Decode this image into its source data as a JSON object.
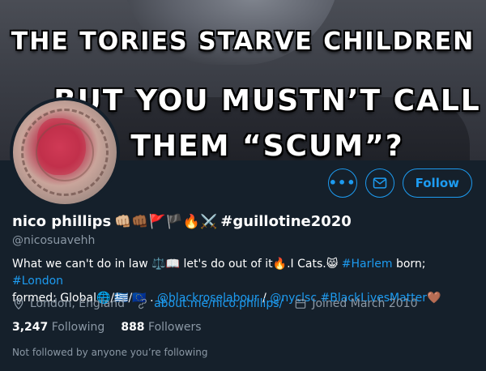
{
  "banner": {
    "line1": "THE TORIES STARVE CHILDREN",
    "line2": "BUT YOU MUSTN’T CALL",
    "line3": "THEM “SCUM”?"
  },
  "colors": {
    "accent": "#1d9bf0",
    "background": "#15202b",
    "muted": "#8b98a5"
  },
  "actions": {
    "more_icon": "more-icon",
    "message_icon": "mail-icon",
    "follow_label": "Follow"
  },
  "profile": {
    "display_name": "nico phillips",
    "name_emojis": "👊🏼👊🏾🚩🏴🔥⚔️",
    "name_hashtag": "#guillotine2020",
    "handle": "@nicosuavehh",
    "bio": {
      "part1": "What we can't do in law ⚖️📖 let's do out of it🔥.I Cats.😸 ",
      "hashtag1": "#Harlem",
      "part2": " born; ",
      "hashtag2": "#London",
      "part3": "formed; Global🌐/🇬🇷/🇪🇺 . ",
      "mention1": "@blackroselabour",
      "part4": " / ",
      "mention2": "@nyclsc",
      "part5": " ",
      "hashtag3": "#BlackLivesMatter",
      "part6": "🤎"
    },
    "location": "London, England",
    "website": "about.me/nico.phillips/",
    "joined": "Joined March 2010",
    "following_count": "3,247",
    "following_label": "Following",
    "followers_count": "888",
    "followers_label": "Followers",
    "not_followed": "Not followed by anyone you’re following"
  }
}
